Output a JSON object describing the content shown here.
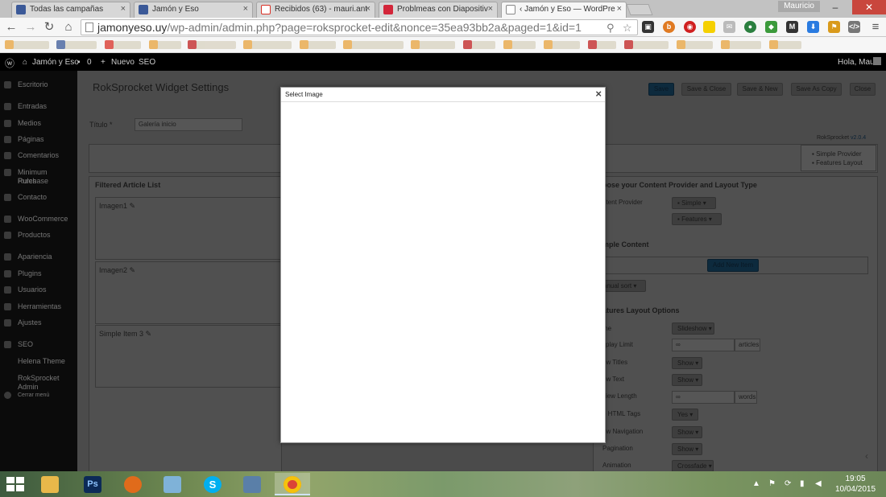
{
  "browser": {
    "tabs": [
      {
        "label": "Todas las campañas",
        "icon": "facebook-icon",
        "color": "#3b5998"
      },
      {
        "label": "Jamón y Eso",
        "icon": "facebook-icon",
        "color": "#3b5998"
      },
      {
        "label": "Recibidos (63) - mauri.ant",
        "icon": "gmail-icon",
        "color": "#d93025"
      },
      {
        "label": "Problmeas con Diapositiv",
        "icon": "wpmu-icon",
        "color": "#d3263a"
      },
      {
        "label": "‹ Jamón y Eso — WordPre",
        "icon": "page-icon",
        "color": "#ffffff"
      }
    ],
    "profile_name": "Mauricio",
    "url_host": "jamonyeso.uy",
    "url_path": "/wp-admin/admin.php?page=roksprocket-edit&nonce=35ea93bb2a&paged=1&id=1"
  },
  "wp_admin_bar": {
    "site_name": "Jamón y Eso",
    "comments_count": "0",
    "new_label": "Nuevo",
    "seo_label": "SEO",
    "greeting": "Hola, Mauri"
  },
  "sidebar": {
    "items": [
      {
        "label": "Escritorio"
      },
      {
        "label": "Entradas"
      },
      {
        "label": "Medios"
      },
      {
        "label": "Páginas"
      },
      {
        "label": "Comentarios"
      },
      {
        "label": "Minimum Purchase"
      },
      {
        "label": "Rules"
      },
      {
        "label": "Contacto"
      },
      {
        "label": "WooCommerce"
      },
      {
        "label": "Productos"
      },
      {
        "label": "Apariencia"
      },
      {
        "label": "Plugins"
      },
      {
        "label": "Usuarios"
      },
      {
        "label": "Herramientas"
      },
      {
        "label": "Ajustes"
      },
      {
        "label": "SEO"
      },
      {
        "label": "Helena Theme"
      },
      {
        "label": "RokSprocket Admin"
      },
      {
        "label": "Cerrar menú"
      }
    ]
  },
  "page": {
    "title": "RokSprocket Widget Settings",
    "buttons": {
      "save": "Save",
      "save_close": "Save & Close",
      "save_new": "Save & New",
      "save_copy": "Save As Copy",
      "close": "Close"
    },
    "title_field_label": "Título",
    "title_field_required": "*",
    "title_field_value": "Galería inicio",
    "version_label": "RokSprocket",
    "version_value": "v2.0.4",
    "provider_chip": "Simple Provider",
    "layout_chip": "Features Layout",
    "filtered_list_label": "Filtered Article List",
    "articles": [
      {
        "label": "Imagen1"
      },
      {
        "label": "Imagen2"
      },
      {
        "label": "Simple Item 3"
      }
    ],
    "content_section": "oose your Content Provider and Layout Type",
    "content_provider_label": "ntent Provider",
    "content_provider_value": "Simple",
    "layout_type_label": "",
    "layout_type_value": "Features",
    "simple_content_section": "mple Content",
    "add_new_item": "Add New Item",
    "sort_value": "anual sort",
    "features_section": "atures Layout Options",
    "options": [
      {
        "label": "me",
        "value": "Slideshow"
      },
      {
        "label": "splay Limit",
        "value": "∞",
        "suffix": "articles"
      },
      {
        "label": "ow Titles",
        "value": "Show"
      },
      {
        "label": "ow Text",
        "value": "Show"
      },
      {
        "label": "view Length",
        "value": "∞",
        "suffix": "words"
      },
      {
        "label": "p HTML Tags",
        "value": "Yes"
      },
      {
        "label": "ow Navigation",
        "value": "Show"
      },
      {
        "label": "Pagination",
        "value": "Show"
      },
      {
        "label": "Animation",
        "value": "Crossfade"
      }
    ]
  },
  "modal": {
    "title": "Select Image",
    "close_glyph": "×"
  },
  "taskbar": {
    "apps": [
      {
        "name": "file-explorer",
        "glyph": "",
        "color": "#e8b84a"
      },
      {
        "name": "photoshop",
        "glyph": "Ps",
        "color": "#0c2a57"
      },
      {
        "name": "firefox",
        "glyph": "",
        "color": "#e06b1b"
      },
      {
        "name": "notes",
        "glyph": "",
        "color": "#7fb2d8"
      },
      {
        "name": "skype",
        "glyph": "S",
        "color": "#00aff0"
      },
      {
        "name": "calculator",
        "glyph": "",
        "color": "#5a7fa8"
      },
      {
        "name": "chrome",
        "glyph": "",
        "color": "#db4437"
      }
    ],
    "time": "19:05",
    "date": "10/04/2015"
  }
}
